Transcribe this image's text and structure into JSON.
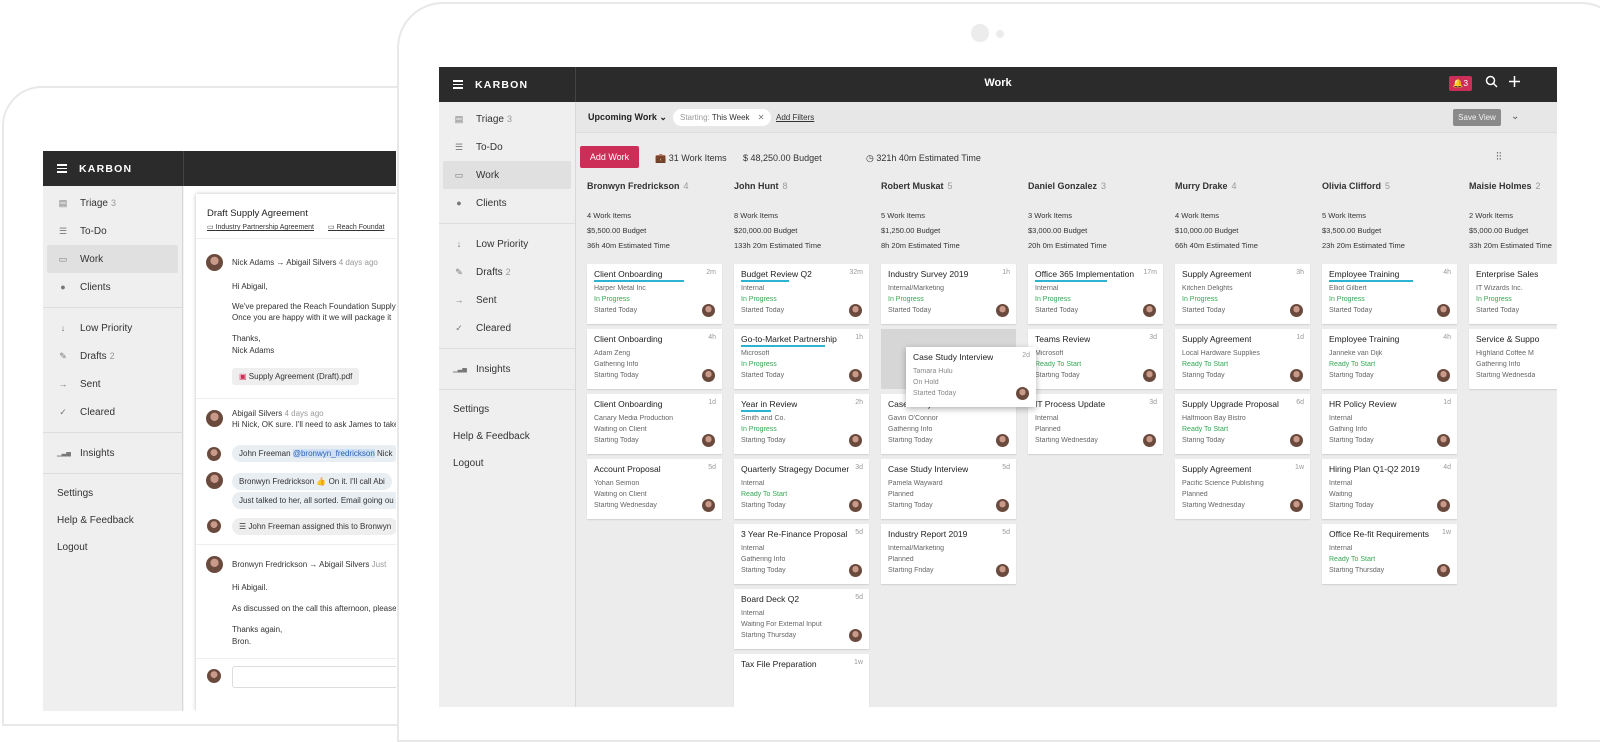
{
  "back": {
    "brand": "KARBON",
    "nav": [
      {
        "label": "Triage",
        "count": "3",
        "icon": "triage-icon"
      },
      {
        "label": "To-Do",
        "icon": "list-icon"
      },
      {
        "label": "Work",
        "icon": "briefcase-icon"
      },
      {
        "label": "Clients",
        "icon": "person-icon"
      }
    ],
    "nav2": [
      {
        "label": "Low Priority",
        "icon": "arrow-down-icon"
      },
      {
        "label": "Drafts",
        "count": "2",
        "icon": "pencil-icon"
      },
      {
        "label": "Sent",
        "icon": "arrow-right-icon"
      },
      {
        "label": "Cleared",
        "icon": "check-icon"
      }
    ],
    "insights": "Insights",
    "links": [
      "Settings",
      "Help & Feedback",
      "Logout"
    ],
    "thread": {
      "title": "Draft Supply Agreement",
      "tag1": "Industry Partnership Agreement",
      "tag2": "Reach Foundat",
      "m1_from": "Nick Adams → Abigail Silvers",
      "m1_time": "4 days ago",
      "m1_l1": "Hi Abigail,",
      "m1_l2": "We've prepared the Reach Foundation Supply",
      "m1_l3": "Once you are happy with it we will package it",
      "m1_l4": "Thanks,",
      "m1_l5": "Nick Adams",
      "attach": "Supply Agreement (Draft).pdf",
      "m2_from": "Abigail Silvers",
      "m2_time": "4 days ago",
      "m2_text": "Hi Nick, OK sure. I'll need to ask James to take",
      "c1_name": "John Freeman",
      "c1_mention": "@bronwyn_fredrickson",
      "c1_rest": "Nick",
      "c2_name": "Bronwyn Fredrickson",
      "c2_rest": "On it. I'll call Abi",
      "c3": "Just talked to her, all sorted. Email going ou",
      "c4": "John Freeman assigned this to Bronwyn",
      "m3_from": "Bronwyn Fredrickson → Abigail Silvers",
      "m3_time": "Just",
      "m3_l1": "Hi Abigail.",
      "m3_l2": "As discussed on the call this afternoon, please",
      "m3_l3": "Thanks again,",
      "m3_l4": "Bron."
    }
  },
  "front": {
    "brand": "KARBON",
    "title": "Work",
    "notif": "3",
    "nav": [
      {
        "label": "Triage",
        "count": "3",
        "icon": "triage-icon"
      },
      {
        "label": "To-Do",
        "icon": "list-icon"
      },
      {
        "label": "Work",
        "icon": "briefcase-icon"
      },
      {
        "label": "Clients",
        "icon": "person-icon"
      }
    ],
    "nav2": [
      {
        "label": "Low Priority",
        "icon": "arrow-down-icon"
      },
      {
        "label": "Drafts",
        "count": "2",
        "icon": "pencil-icon"
      },
      {
        "label": "Sent",
        "icon": "arrow-right-icon"
      },
      {
        "label": "Cleared",
        "icon": "check-icon"
      }
    ],
    "insights": "Insights",
    "links": [
      "Settings",
      "Help & Feedback",
      "Logout"
    ],
    "filter": {
      "view": "Upcoming Work",
      "chip_label": "Starting:",
      "chip_value": "This Week",
      "add": "Add Filters",
      "save": "Save View"
    },
    "summary": {
      "add": "Add Work",
      "items": "31 Work Items",
      "budget": "48,250.00 Budget",
      "time": "321h 40m Estimated Time"
    },
    "columns": [
      {
        "name": "Bronwyn Fredrickson",
        "count": "4",
        "s1": "4 Work Items",
        "s2": "$5,500.00 Budget",
        "s3": "36h 40m Estimated Time",
        "cards": [
          {
            "t": "Client Onboarding",
            "a": "2m",
            "c": "Harper Metal Inc",
            "st": "In Progress",
            "d": "Started Today",
            "bar": 0.75
          },
          {
            "t": "Client Onboarding",
            "a": "4h",
            "c": "Adam Zeng",
            "st": "Gathering Info",
            "d": "Starting Today"
          },
          {
            "t": "Client Onboarding",
            "a": "1d",
            "c": "Canary Media Production",
            "st": "Waiting on Client",
            "d": "Starting Today"
          },
          {
            "t": "Account Proposal",
            "a": "5d",
            "c": "Yohan Seimon",
            "st": "Waiting on Client",
            "d": "Starting Wednesday"
          }
        ]
      },
      {
        "name": "John Hunt",
        "count": "8",
        "s1": "8 Work Items",
        "s2": "$20,000.00 Budget",
        "s3": "133h 20m Estimated Time",
        "cards": [
          {
            "t": "Budget Review Q2",
            "a": "32m",
            "c": "Internal",
            "st": "In Progress",
            "d": "Started Today",
            "bar": 0.4
          },
          {
            "t": "Go-to-Market Partnership",
            "a": "1h",
            "c": "Microsoft",
            "st": "In Progress",
            "d": "Started Today",
            "bar": 0.7
          },
          {
            "t": "Year in Review",
            "a": "2h",
            "c": "Smith and Co.",
            "st": "In Progress",
            "d": "Starting Today",
            "bar": 0.25
          },
          {
            "t": "Quarterly Stragegy Document",
            "a": "3d",
            "c": "Internal",
            "st": "Ready To Start",
            "d": "Starting Today"
          },
          {
            "t": "3 Year Re-Finance Proposal",
            "a": "5d",
            "c": "Internal",
            "st": "Gathering Info",
            "d": "Starting Today"
          },
          {
            "t": "Board Deck Q2",
            "a": "5d",
            "c": "Internal",
            "st": "Waiting For External Input",
            "d": "Starting Thursday"
          },
          {
            "t": "Tax File Preparation",
            "a": "1w",
            "c": "",
            "st": "",
            "d": ""
          }
        ]
      },
      {
        "name": "Robert Muskat",
        "count": "5",
        "s1": "5 Work Items",
        "s2": "$1,250.00 Budget",
        "s3": "8h 20m Estimated Time",
        "cards": [
          {
            "t": "Industry Survey 2019",
            "a": "1h",
            "c": "Internal/Marketing",
            "st": "In Progress",
            "d": "Started Today"
          },
          {
            "t": "",
            "a": "",
            "c": "",
            "st": "",
            "d": "",
            "ghost": true
          },
          {
            "t": "Case Study Interview",
            "a": "",
            "c": "Gavin O'Connor",
            "st": "Gathering Info",
            "d": "Starting Today"
          },
          {
            "t": "Case Study Interview",
            "a": "5d",
            "c": "Pamela Wayward",
            "st": "Planned",
            "d": "Starting Today"
          },
          {
            "t": "Industry Report 2019",
            "a": "5d",
            "c": "Internal/Marketing",
            "st": "Planned",
            "d": "Starting Friday"
          }
        ]
      },
      {
        "name": "Daniel Gonzalez",
        "count": "3",
        "s1": "3 Work Items",
        "s2": "$3,000.00 Budget",
        "s3": "20h 0m Estimated Time",
        "cards": [
          {
            "t": "Office 365 Implementation",
            "a": "17m",
            "c": "Internal",
            "st": "In Progress",
            "d": "Started Today",
            "bar": 0.6
          },
          {
            "t": "Teams Review",
            "a": "3d",
            "c": "Microsoft",
            "st": "Ready To Start",
            "d": "Starting Today"
          },
          {
            "t": "IT Process Update",
            "a": "3d",
            "c": "Internal",
            "st": "Planned",
            "d": "Starting Wednesday"
          }
        ]
      },
      {
        "name": "Murry Drake",
        "count": "4",
        "s1": "4 Work Items",
        "s2": "$10,000.00 Budget",
        "s3": "66h 40m Estimated Time",
        "cards": [
          {
            "t": "Supply Agreement",
            "a": "3h",
            "c": "Kitchen Delights",
            "st": "In Progress",
            "d": "Started Today"
          },
          {
            "t": "Supply Agreement",
            "a": "1d",
            "c": "Local Hardware Supplies",
            "st": "Ready To Start",
            "d": "Staring Today"
          },
          {
            "t": "Supply Upgrade Proposal",
            "a": "6d",
            "c": "Halfmoon Bay Bistro",
            "st": "Ready To Start",
            "d": "Staring Today"
          },
          {
            "t": "Supply Agreement",
            "a": "1w",
            "c": "Pacific Science Publishing",
            "st": "Planned",
            "d": "Starting Wednesday"
          }
        ]
      },
      {
        "name": "Olivia Clifford",
        "count": "5",
        "s1": "5 Work Items",
        "s2": "$3,500.00 Budget",
        "s3": "23h 20m Estimated Time",
        "cards": [
          {
            "t": "Employee Training",
            "a": "4h",
            "c": "Elliot Gilbert",
            "st": "In Progress",
            "d": "Started Today",
            "bar": 0.7
          },
          {
            "t": "Employee Training",
            "a": "4h",
            "c": "Janneke van Dijk",
            "st": "Ready To Start",
            "d": "Starting Today"
          },
          {
            "t": "HR Policy Review",
            "a": "1d",
            "c": "Internal",
            "st": "Gathing Info",
            "d": "Starting Today"
          },
          {
            "t": "Hiring Plan Q1-Q2 2019",
            "a": "4d",
            "c": "Internal",
            "st": "Waiting",
            "d": "Starting Today"
          },
          {
            "t": "Office Re-fit Requirements",
            "a": "1w",
            "c": "Internal",
            "st": "Ready To Start",
            "d": "Starting Thursday"
          }
        ]
      },
      {
        "name": "Maisie Holmes",
        "count": "2",
        "s1": "2 Work Items",
        "s2": "$5,000.00 Budget",
        "s3": "33h 20m Estimated Time",
        "cards": [
          {
            "t": "Enterprise Sales",
            "a": "",
            "c": "IT Wizards Inc.",
            "st": "In Progress",
            "d": "Started Today"
          },
          {
            "t": "Service & Suppo",
            "a": "",
            "c": "Highland Coffee M",
            "st": "Gathering Info",
            "d": "Starting Wednesda"
          }
        ]
      }
    ],
    "popup": {
      "t": "Case Study Interview",
      "a": "2d",
      "c": "Tamara Hulu",
      "st": "On Hold",
      "d": "Started Today"
    }
  }
}
